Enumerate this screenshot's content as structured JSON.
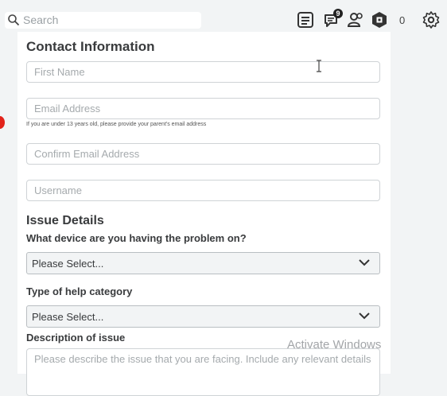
{
  "search": {
    "placeholder": "Search"
  },
  "nav": {
    "icons": [
      "list-icon",
      "chat-icon",
      "friends-icon",
      "robux-icon",
      "settings-icon"
    ],
    "chat_badge": "9",
    "robux_count": "0"
  },
  "contact": {
    "title": "Contact Information",
    "first_name_placeholder": "First Name",
    "email_placeholder": "Email Address",
    "email_hint": "If you are under 13 years old, please provide your parent's email address",
    "confirm_email_placeholder": "Confirm Email Address",
    "username_placeholder": "Username"
  },
  "issue": {
    "title": "Issue Details",
    "device_label": "What device are you having the problem on?",
    "device_value": "Please Select...",
    "category_label": "Type of help category",
    "category_value": "Please Select...",
    "description_label": "Description of issue",
    "description_placeholder": "Please describe the issue that you are facing. Include any relevant details"
  },
  "watermark": "Activate Windows",
  "colors": {
    "accent": "#e2231a",
    "card": "#ffffff",
    "page": "#f2f4f5"
  }
}
